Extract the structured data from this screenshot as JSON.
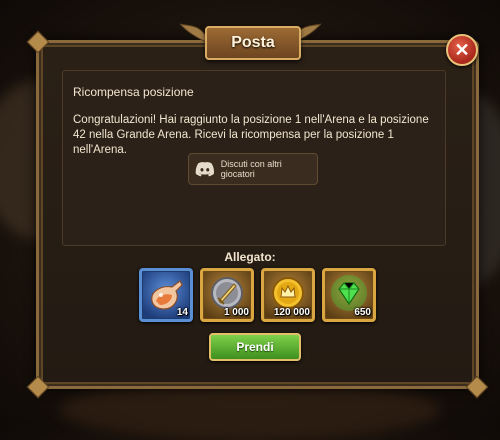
{
  "window": {
    "title": "Posta"
  },
  "mail": {
    "section_title": "Ricompensa posizione",
    "message": "Congratulazioni! Hai raggiunto la posizione 1 nell'Arena e la posizione 42 nella Grande Arena. Ricevi la ricompensa per la posizione 1 nell'Arena.",
    "discuss_button": "Discuti con altri giocatori"
  },
  "attachments": {
    "label": "Allegato:",
    "items": [
      {
        "icon": "potion-icon",
        "count": "14",
        "frame": "blue"
      },
      {
        "icon": "sword-coin-icon",
        "count": "1 000",
        "frame": "gold"
      },
      {
        "icon": "gold-coin-icon",
        "count": "120 000",
        "frame": "gold"
      },
      {
        "icon": "emerald-icon",
        "count": "650",
        "frame": "gold"
      }
    ]
  },
  "actions": {
    "take_button": "Prendi"
  },
  "colors": {
    "frame_gold": "#d9a641",
    "button_green": "#5bb034",
    "close_red": "#c0392b"
  }
}
